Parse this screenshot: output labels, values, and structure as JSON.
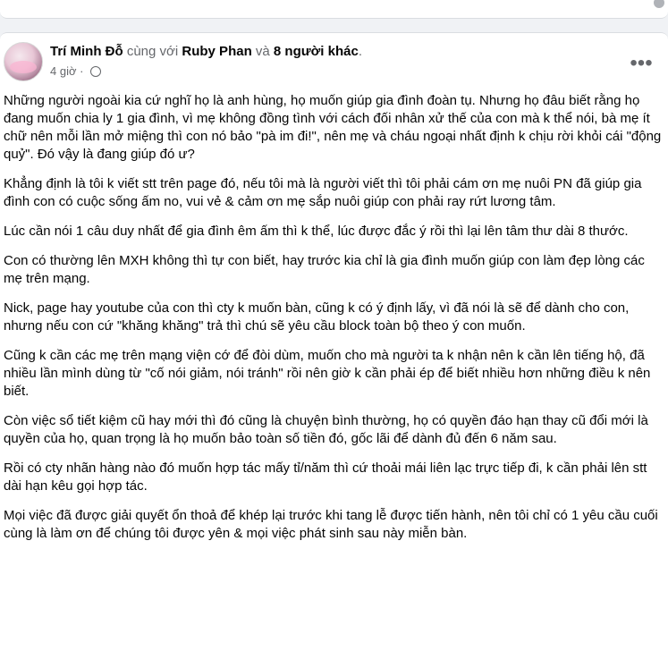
{
  "post": {
    "author": "Trí Minh Đỗ",
    "with_prefix": "cùng với",
    "tagged_name": "Ruby Phan",
    "and_text": "và",
    "others_text": "8 người khác",
    "period": ".",
    "timestamp": "4 giờ",
    "separator": "·",
    "more_label": "•••",
    "paragraphs": [
      "Những người ngoài kia cứ nghĩ họ là anh hùng, họ muốn giúp gia đình đoàn tụ. Nhưng họ đâu biết rằng họ đang muốn chia ly 1 gia đình, vì mẹ không đồng tình với cách đối nhân xử thế của con mà k thể nói, bà mẹ ít chữ nên mỗi lần mở miệng thì con nó bảo \"pà im đi!\", nên mẹ và cháu ngoại nhất định k chịu rời khỏi cái \"động quỷ\". Đó vậy là đang giúp đó ư?",
      "Khẳng định là tôi k viết stt trên page đó, nếu tôi mà là người viết thì tôi phải cám ơn mẹ nuôi PN đã giúp gia đình con có cuộc sống ấm no, vui vẻ & cảm ơn mẹ sắp nuôi giúp con phải ray rứt lương tâm.",
      "Lúc cần nói 1 câu duy nhất để gia đình êm ấm thì k thể, lúc được đắc ý rồi thì lại lên tâm thư dài 8 thước.",
      "Con có thường lên MXH không thì tự con biết, hay trước kia chỉ là gia đình muốn giúp con làm đẹp lòng các mẹ trên mạng.",
      "Nick, page hay youtube của con thì cty k muốn bàn, cũng k có ý định lấy, vì đã nói là sẽ để dành cho con, nhưng nếu con cứ \"khăng khăng\" trả thì chú sẽ yêu cầu block toàn bộ theo ý con muốn.",
      "Cũng k cần các mẹ trên mạng viện cớ để đòi dùm, muốn cho mà người ta k nhận nên k cần lên tiếng hộ, đã nhiều lần mình dùng từ \"cố nói giảm, nói tránh\" rồi nên giờ k cần phải ép để biết nhiều hơn những điều k nên biết.",
      "Còn việc sổ tiết kiệm cũ hay mới thì đó cũng là chuyện bình thường, họ có quyền đáo hạn thay cũ đổi mới là quyền của họ, quan trọng là họ muốn bảo toàn số tiền đó, gốc lãi để dành đủ đến 6 năm sau.",
      "Rồi có cty nhãn hàng nào đó muốn hợp tác mấy tỉ/năm thì cứ thoải mái liên lạc trực tiếp đi, k cần phải lên stt dài hạn kêu gọi hợp tác.",
      "Mọi việc đã được giải quyết ổn thoả để khép lại trước khi tang lễ được tiến hành, nên tôi chỉ có 1 yêu cầu cuối cùng là làm ơn để chúng tôi được yên & mọi việc phát sinh sau này miễn bàn."
    ]
  }
}
